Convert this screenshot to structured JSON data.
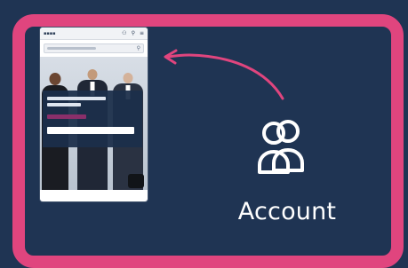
{
  "colors": {
    "background": "#1f3453",
    "frame_border": "#e0457e",
    "label_text": "#ffffff"
  },
  "phone": {
    "hero_image": "group-of-business-people-photo"
  },
  "account": {
    "icon": "users-icon",
    "label": "Account"
  },
  "annotation": {
    "icon": "curved-arrow-icon"
  }
}
